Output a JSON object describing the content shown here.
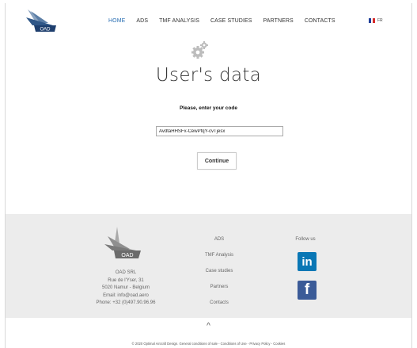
{
  "header": {
    "nav": [
      {
        "label": "HOME",
        "active": true
      },
      {
        "label": "ADS",
        "active": false
      },
      {
        "label": "TMF ANALYSIS",
        "active": false
      },
      {
        "label": "CASE STUDIES",
        "active": false
      },
      {
        "label": "PARTNERS",
        "active": false
      },
      {
        "label": "CONTACTS",
        "active": false
      }
    ],
    "language": "FR",
    "logo_text": "OAD"
  },
  "main": {
    "title": "User's data",
    "prompt": "Please, enter your code",
    "code_value": "AvdtaHHSFx-CewPfqY-cvTjesx",
    "continue_label": "Continue"
  },
  "footer": {
    "address": [
      "OAD SRL",
      "Rue de l'Yser, 31",
      "5020 Namur - Belgium",
      "Email: info@oad.aero",
      "Phone: +32 (0)497.90.96.96"
    ],
    "links": [
      "ADS",
      "TMF Analysis",
      "Case studies",
      "Partners",
      "Contacts"
    ],
    "follow_label": "Follow us",
    "linkedin_label": "in",
    "facebook_label": "f",
    "scroll_top": "^",
    "legal": "© 2020 Optimal Aircraft Design. General conditions of sale  -  Conditions of Use  -  Privacy Policy  -  Cookies"
  },
  "colors": {
    "nav_active": "#2a6fb3",
    "footer_bg": "#ececec",
    "linkedin": "#0a77b5",
    "facebook": "#3b5b98",
    "logo_blue": "#1e3f6e"
  }
}
